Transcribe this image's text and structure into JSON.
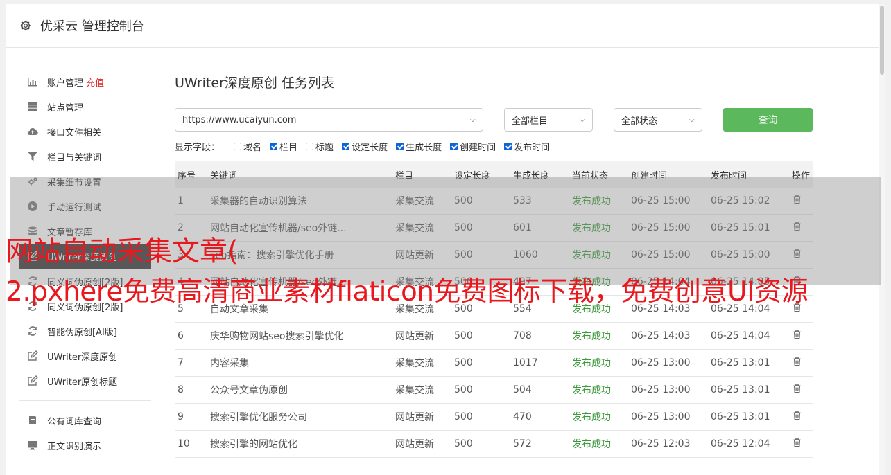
{
  "app": {
    "title": "优采云 管理控制台"
  },
  "sidebar": {
    "items": [
      {
        "label": "账户管理",
        "extra": "充值",
        "icon": "bar-chart-icon"
      },
      {
        "label": "站点管理",
        "icon": "server-icon"
      },
      {
        "label": "接口文件相关",
        "icon": "cloud-upload-icon"
      },
      {
        "label": "栏目与关键词",
        "icon": "filter-icon"
      },
      {
        "label": "采集细节设置",
        "icon": "gears-icon"
      },
      {
        "label": "手动运行测试",
        "icon": "play-circle-icon"
      },
      {
        "label": "文章暂存库",
        "icon": "database-icon"
      },
      {
        "label": "UWriter深度原创",
        "icon": "edit-icon",
        "active": true
      },
      {
        "label": "同义词伪原创[2版]",
        "icon": "refresh-icon"
      },
      {
        "label": "同义词伪原创[2版]",
        "icon": "refresh-icon"
      },
      {
        "label": "智能伪原创[AI版]",
        "icon": "refresh-icon"
      },
      {
        "label": "UWriter深度原创",
        "icon": "edit-icon"
      },
      {
        "label": "UWriter原创标题",
        "icon": "edit-icon"
      }
    ],
    "bottom_items": [
      {
        "label": "公有词库查询",
        "icon": "book-icon"
      },
      {
        "label": "正文识别演示",
        "icon": "monitor-icon"
      }
    ]
  },
  "main": {
    "title": "UWriter深度原创 任务列表",
    "site_select": "https://www.ucaiyun.com",
    "column_select": "全部栏目",
    "status_select": "全部状态",
    "query_button": "查询",
    "fields_label": "显示字段：",
    "fields": [
      {
        "label": "域名",
        "checked": false
      },
      {
        "label": "栏目",
        "checked": true
      },
      {
        "label": "标题",
        "checked": false
      },
      {
        "label": "设定长度",
        "checked": true
      },
      {
        "label": "生成长度",
        "checked": true
      },
      {
        "label": "创建时间",
        "checked": true
      },
      {
        "label": "发布时间",
        "checked": true
      }
    ],
    "table": {
      "headers": [
        "序号",
        "关键词",
        "栏目",
        "设定长度",
        "生成长度",
        "当前状态",
        "创建时间",
        "发布时间",
        "操作"
      ],
      "rows": [
        [
          "1",
          "采集器的自动识别算法",
          "采集交流",
          "500",
          "533",
          "发布成功",
          "06-25 15:00",
          "06-25 15:02"
        ],
        [
          "2",
          "网站自动化宣传机器/seo外链...",
          "采集交流",
          "500",
          "601",
          "发布成功",
          "06-25 15:00",
          "06-25 15:01"
        ],
        [
          "3",
          "seo指南：搜索引擎优化手册",
          "网站更新",
          "500",
          "1060",
          "发布成功",
          "06-25 15:00",
          "06-25 15:00"
        ],
        [
          "4",
          "网站自动化宣传机器/seo外链...",
          "采集交流",
          "500",
          "497",
          "发布成功",
          "06-25 14:04",
          "06-25 14:05"
        ],
        [
          "5",
          "自动文章采集",
          "采集交流",
          "500",
          "554",
          "发布成功",
          "06-25 14:03",
          "06-25 14:04"
        ],
        [
          "6",
          "庆华购物网站seo搜索引擎优化",
          "网站更新",
          "500",
          "708",
          "发布成功",
          "06-25 14:03",
          "06-25 14:04"
        ],
        [
          "7",
          "内容采集",
          "采集交流",
          "500",
          "1017",
          "发布成功",
          "06-25 13:00",
          "06-25 13:01"
        ],
        [
          "8",
          "公众号文章伪原创",
          "采集交流",
          "500",
          "504",
          "发布成功",
          "06-25 13:00",
          "06-25 13:01"
        ],
        [
          "9",
          "搜索引擎优化服务公司",
          "网站更新",
          "500",
          "470",
          "发布成功",
          "06-25 13:00",
          "06-25 13:01"
        ],
        [
          "10",
          "搜索引擎的网站优化",
          "网站更新",
          "500",
          "572",
          "发布成功",
          "06-25 12:03",
          "06-25 12:04"
        ]
      ]
    }
  },
  "overlay": {
    "line1": "网站自动采集文章(",
    "line2": "2.pxhere免费高清商业素材flaticon免费图标下载，免费创意UI资源"
  },
  "colors": {
    "query_green": "#5cb85c",
    "status_green": "#3c9a3c",
    "recharge_red": "#e02020",
    "overlay_red": "#e8181e"
  }
}
